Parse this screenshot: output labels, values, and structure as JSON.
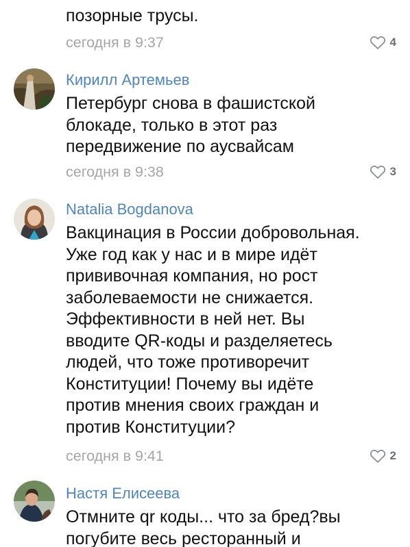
{
  "comments": [
    {
      "author": "",
      "text": "позорные трусы.",
      "time": "сегодня в 9:37",
      "likes": "4",
      "avatar_icon": "avatar-icon"
    },
    {
      "author": "Кирилл Артемьев",
      "text": "Петербург снова в фашистской\nблокаде, только в этот раз\nпередвижение по аусвайсам",
      "time": "сегодня в 9:38",
      "likes": "3",
      "avatar_icon": "avatar-icon"
    },
    {
      "author": "Natalia Bogdanova",
      "text": "Вакцинация в России добровольная.\nУже год как у нас и в мире идёт\nпрививочная компания, но рост\nзаболеваемости не снижается.\nЭффективности в ней нет. Вы\nвводите QR-коды и разделяетесь\nлюдей, что тоже противоречит\nКонституции! Почему вы идёте\nпротив мнения своих граждан и\nпротив Конституции?",
      "time": "сегодня в 9:41",
      "likes": "2",
      "avatar_icon": "avatar-icon"
    },
    {
      "author": "Настя Елисеева",
      "text": "Отмните qr коды... что за бред?вы\nпогубите весь ресторанный и",
      "time": "",
      "likes": "",
      "avatar_icon": "avatar-icon"
    }
  ],
  "colors": {
    "author": "#4f85bd",
    "text": "#111111",
    "meta": "#a3a6ab",
    "heart": "#8a8f96"
  },
  "icons": {
    "like": "heart-outline-icon"
  }
}
